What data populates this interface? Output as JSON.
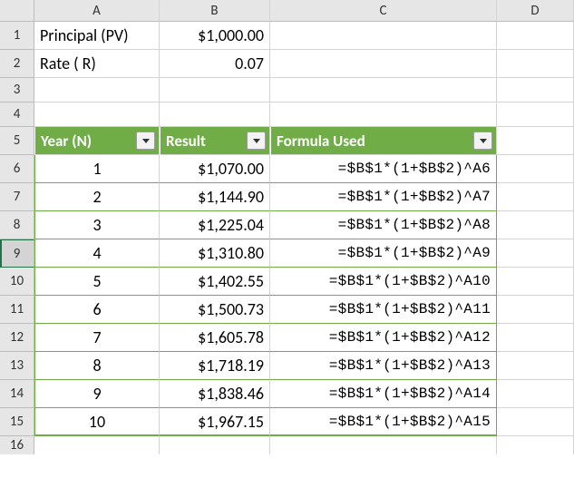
{
  "columns": {
    "A": "A",
    "B": "B",
    "C": "C",
    "D": "D"
  },
  "row_labels": [
    "1",
    "2",
    "3",
    "4",
    "5",
    "6",
    "7",
    "8",
    "9",
    "10",
    "11",
    "12",
    "13",
    "14",
    "15",
    "16"
  ],
  "inputs": {
    "principal_label": "Principal (PV)",
    "principal_value": "$1,000.00",
    "rate_label": "Rate ( R)",
    "rate_value": "0.07"
  },
  "table_header": {
    "year": "Year (N)",
    "result": "Result",
    "formula": "Formula Used"
  },
  "rows": [
    {
      "year": "1",
      "result": "$1,070.00",
      "formula": "=$B$1*(1+$B$2)^A6"
    },
    {
      "year": "2",
      "result": "$1,144.90",
      "formula": "=$B$1*(1+$B$2)^A7"
    },
    {
      "year": "3",
      "result": "$1,225.04",
      "formula": "=$B$1*(1+$B$2)^A8"
    },
    {
      "year": "4",
      "result": "$1,310.80",
      "formula": "=$B$1*(1+$B$2)^A9"
    },
    {
      "year": "5",
      "result": "$1,402.55",
      "formula": "=$B$1*(1+$B$2)^A10"
    },
    {
      "year": "6",
      "result": "$1,500.73",
      "formula": "=$B$1*(1+$B$2)^A11"
    },
    {
      "year": "7",
      "result": "$1,605.78",
      "formula": "=$B$1*(1+$B$2)^A12"
    },
    {
      "year": "8",
      "result": "$1,718.19",
      "formula": "=$B$1*(1+$B$2)^A13"
    },
    {
      "year": "9",
      "result": "$1,838.46",
      "formula": "=$B$1*(1+$B$2)^A14"
    },
    {
      "year": "10",
      "result": "$1,967.15",
      "formula": "=$B$1*(1+$B$2)^A15"
    }
  ],
  "chart_data": {
    "type": "table",
    "title": "Compound interest future value by year",
    "principal": 1000.0,
    "rate": 0.07,
    "columns": [
      "Year (N)",
      "Result",
      "Formula Used"
    ],
    "series": [
      {
        "name": "Year (N)",
        "values": [
          1,
          2,
          3,
          4,
          5,
          6,
          7,
          8,
          9,
          10
        ]
      },
      {
        "name": "Result",
        "values": [
          1070.0,
          1144.9,
          1225.04,
          1310.8,
          1402.55,
          1500.73,
          1605.78,
          1718.19,
          1838.46,
          1967.15
        ]
      }
    ],
    "formula_template": "=$B$1*(1+$B$2)^A{row}"
  },
  "selected_row_header": 9
}
